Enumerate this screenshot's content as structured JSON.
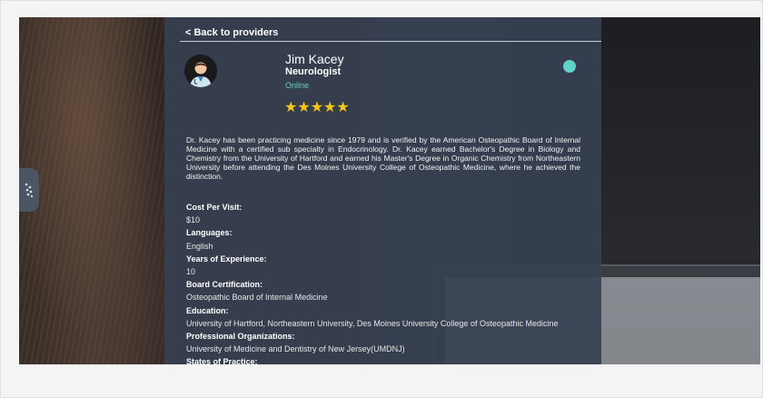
{
  "back_link": "< Back to providers",
  "provider": {
    "name": "Jim Kacey",
    "specialty": "Neurologist",
    "status": "Online",
    "rating_stars": "★★★★★",
    "rating": 5,
    "status_color": "#5fd3c8"
  },
  "bio": "Dr. Kacey has been practicing medicine since 1979 and is verified by the American Osteopathic Board of Internal Medicine with a certified sub specialty in Endocrinology. Dr. Kacey earned Bachelor's Degree in Biology and Chemistry from the University of Hartford and earned his Master's Degree in Organic Chemistry from Northeastern University before attending the Des Moines University College of Osteopathic Medicine, where he achieved the distinction.",
  "details": [
    {
      "label": "Cost Per Visit:",
      "value": "$10"
    },
    {
      "label": "Languages:",
      "value": "English"
    },
    {
      "label": "Years of Experience:",
      "value": "10"
    },
    {
      "label": "Board Certification:",
      "value": "Osteopathic Board of Internal Medicine"
    },
    {
      "label": "Education:",
      "value": "University of Hartford, Northeastern University, Des Moines University College of Osteopathic Medicine"
    },
    {
      "label": "Professional Organizations:",
      "value": "University of Medicine and Dentistry of New Jersey(UMDNJ)"
    },
    {
      "label": "States of Practice:",
      "value": ""
    }
  ],
  "icons": {
    "side_tab": "sparkle-icon",
    "avatar": "doctor-avatar-icon"
  }
}
